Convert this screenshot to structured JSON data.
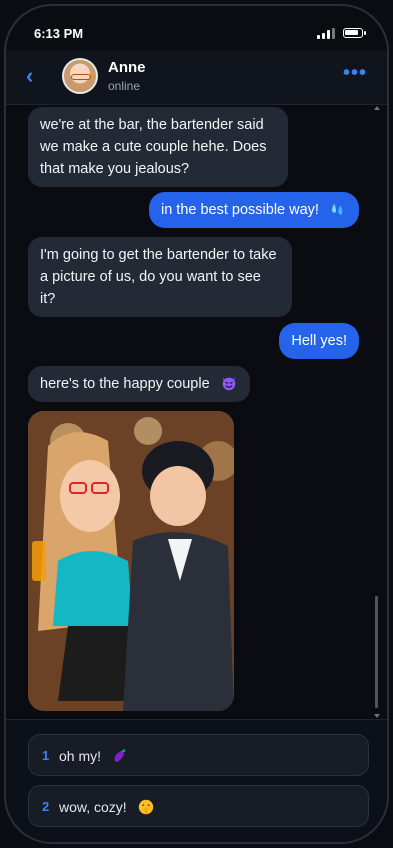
{
  "status_bar": {
    "time": "6:13 PM"
  },
  "contact": {
    "name": "Anne",
    "presence": "online"
  },
  "header": {
    "back_icon": "chevron-left-icon",
    "menu_icon": "more-dots-icon"
  },
  "messages": [
    {
      "from": "contact",
      "text": "we're at the bar, the bartender said we make a cute couple hehe. Does that make you jealous?"
    },
    {
      "from": "user",
      "text": "in the best possible way!",
      "emoji": "sweat-droplets-emoji"
    },
    {
      "from": "contact",
      "text": "I'm going to get the bartender to take a picture of us, do you want to see it?"
    },
    {
      "from": "user",
      "text": "Hell yes!"
    },
    {
      "from": "contact",
      "text": "here's to the happy couple",
      "emoji": "smiling-devil-emoji"
    },
    {
      "from": "contact",
      "type": "image",
      "image": "couple-photo"
    }
  ],
  "reply_options": [
    {
      "number": "1",
      "text": "oh my!",
      "emoji": "eggplant-emoji"
    },
    {
      "number": "2",
      "text": "wow, cozy!",
      "emoji": "shushing-face-emoji"
    }
  ],
  "colors": {
    "accent": "#2563eb",
    "incoming_bubble": "#232a36",
    "background": "#0a0c11"
  }
}
